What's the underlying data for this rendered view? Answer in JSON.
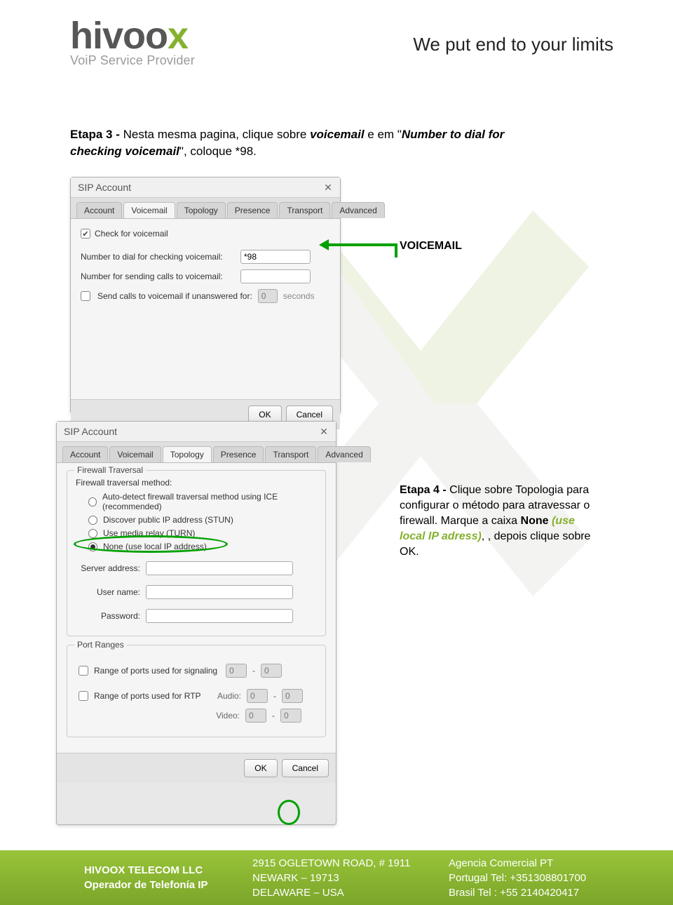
{
  "header": {
    "logo_main": "hivoo",
    "logo_accent": "x",
    "logo_tagline": "VoiP Service Provider",
    "slogan": "We put end to your limits"
  },
  "etapa3": {
    "prefix": "Etapa 3 - ",
    "part1": "Nesta mesma pagina, clique sobre ",
    "voicemail_word": "voicemail",
    "part2": " e em \"",
    "numbertodial": "Number to dial for checking voicemail",
    "part3": "\", coloque *98."
  },
  "vm_annotation": "VOICEMAIL",
  "dialog1": {
    "title": "SIP Account",
    "tabs": [
      "Account",
      "Voicemail",
      "Topology",
      "Presence",
      "Transport",
      "Advanced"
    ],
    "active_tab": 1,
    "check_label": "Check for voicemail",
    "num_dial_label": "Number to dial for checking voicemail:",
    "num_dial_value": "*98",
    "num_send_label": "Number for sending calls to voicemail:",
    "num_send_value": "",
    "unanswered_label": "Send calls to voicemail if unanswered for:",
    "unanswered_value": "0",
    "seconds": "seconds",
    "ok": "OK",
    "cancel": "Cancel"
  },
  "etapa4": {
    "prefix": "Etapa 4 - ",
    "part1": "Clique sobre Topologia para configurar o método para atravessar o firewall. Marque a caixa ",
    "none_bold": "None ",
    "none_green": "(use local IP adress)",
    "part2": ", , depois clique sobre OK."
  },
  "dialog2": {
    "title": "SIP Account",
    "tabs": [
      "Account",
      "Voicemail",
      "Topology",
      "Presence",
      "Transport",
      "Advanced"
    ],
    "active_tab": 2,
    "fieldset1_title": "Firewall Traversal",
    "method_label": "Firewall traversal method:",
    "radios": [
      "Auto-detect firewall traversal method using ICE (recommended)",
      "Discover public IP address (STUN)",
      "Use media relay (TURN)",
      "None (use local IP address)"
    ],
    "selected_radio": 3,
    "server_label": "Server address:",
    "user_label": "User name:",
    "pass_label": "Password:",
    "fieldset2_title": "Port Ranges",
    "range_sig_label": "Range of ports used for signaling",
    "range_rtp_label": "Range of ports used for RTP",
    "audio_label": "Audio:",
    "video_label": "Video:",
    "zero": "0",
    "ok": "OK",
    "cancel": "Cancel"
  },
  "footer": {
    "company1": "HIVOOX TELECOM LLC",
    "company2": "Operador de Telefonía IP",
    "addr1": "2915 OGLETOWN ROAD, # 1911",
    "addr2": "NEWARK – 19713",
    "addr3": "DELAWARE  – USA",
    "ag1": "Agencia Comercial PT",
    "ag2": "Portugal Tel:  +351308801700",
    "ag3": "Brasil Tel  :  +55 2140420417"
  }
}
